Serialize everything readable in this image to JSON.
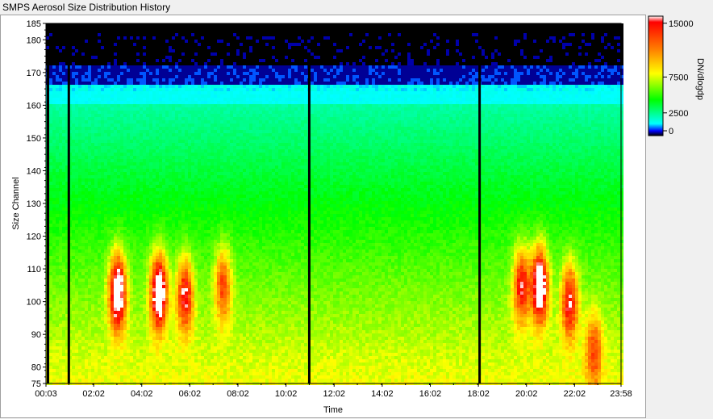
{
  "window": {
    "title": "SMPS Aerosol Size Distribution History"
  },
  "chart_data": {
    "type": "heatmap",
    "title": "SMPS Aerosol Size Distribution History",
    "xlabel": "Time",
    "ylabel": "Size Channel",
    "x_ticks": [
      "00:03",
      "02:02",
      "04:02",
      "06:02",
      "08:02",
      "10:02",
      "12:02",
      "14:02",
      "16:02",
      "18:02",
      "20:02",
      "22:02",
      "23:58"
    ],
    "y_ticks": [
      75,
      80,
      90,
      100,
      110,
      120,
      130,
      140,
      150,
      160,
      170,
      180,
      185
    ],
    "xlim": [
      "00:03",
      "23:58"
    ],
    "ylim": [
      75,
      185
    ],
    "colorbar": {
      "label": "DN/dlogdp",
      "ticks": [
        {
          "value": 0,
          "label": "0"
        },
        {
          "value": 2500,
          "label": "2500"
        },
        {
          "value": 7500,
          "label": "7500"
        },
        {
          "value": 15000,
          "label": "15000"
        }
      ],
      "range": [
        0,
        15000
      ],
      "colors": [
        "#000000",
        "#00ffff",
        "#00ff00",
        "#ffff00",
        "#ff8000",
        "#ff0000",
        "#ffffff"
      ]
    },
    "gaps": [
      "00:08",
      "01:00",
      "11:00",
      "18:05"
    ],
    "hotspots": [
      {
        "time": "03:02",
        "channel": 103,
        "value": 16000
      },
      {
        "time": "04:45",
        "channel": 103,
        "value": 16000
      },
      {
        "time": "05:50",
        "channel": 102,
        "value": 12000
      },
      {
        "time": "07:25",
        "channel": 105,
        "value": 10000
      },
      {
        "time": "19:50",
        "channel": 105,
        "value": 12000
      },
      {
        "time": "20:35",
        "channel": 105,
        "value": 16000
      },
      {
        "time": "21:50",
        "channel": 100,
        "value": 12000
      },
      {
        "time": "22:50",
        "channel": 85,
        "value": 9000
      }
    ]
  }
}
